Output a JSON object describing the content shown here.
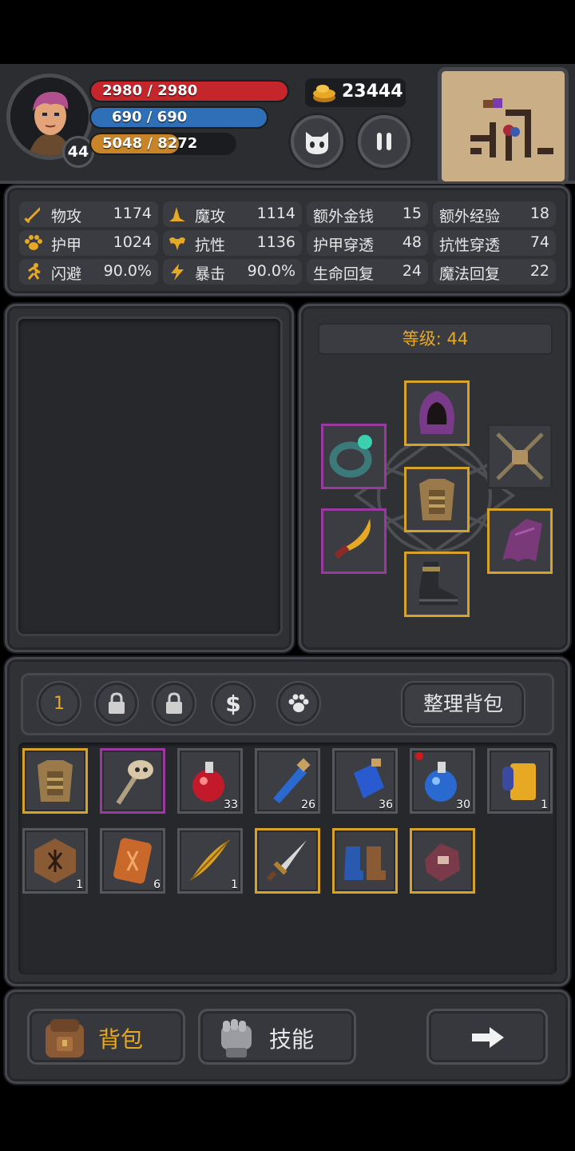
{
  "hud": {
    "hp": {
      "current": 2980,
      "max": 2980,
      "text": "2980 / 2980",
      "fraction": 1.0,
      "color": "#c5262c"
    },
    "mp": {
      "current": 690,
      "max": 690,
      "text": "690 / 690",
      "fraction": 1.0,
      "color": "#2f6fb8"
    },
    "xp": {
      "current": 5048,
      "max": 8272,
      "text": "5048 / 8272",
      "fraction": 0.61,
      "color": "#c98427"
    },
    "player_level": "44",
    "gold": "23444"
  },
  "stats": [
    {
      "label": "物攻",
      "value": "1174",
      "icon": "sword-icon"
    },
    {
      "label": "魔攻",
      "value": "1114",
      "icon": "wizard-hat-icon"
    },
    {
      "label": "额外金钱",
      "value": "15"
    },
    {
      "label": "额外经验",
      "value": "18"
    },
    {
      "label": "护甲",
      "value": "1024",
      "icon": "paw-icon"
    },
    {
      "label": "抗性",
      "value": "1136",
      "icon": "muscle-icon"
    },
    {
      "label": "护甲穿透",
      "value": "48"
    },
    {
      "label": "抗性穿透",
      "value": "74"
    },
    {
      "label": "闪避",
      "value": "90.0%",
      "icon": "running-icon"
    },
    {
      "label": "暴击",
      "value": "90.0%",
      "icon": "lightning-icon"
    },
    {
      "label": "生命回复",
      "value": "24"
    },
    {
      "label": "魔法回复",
      "value": "22"
    }
  ],
  "equipment": {
    "level_label": "等级: 44",
    "slots": [
      {
        "item": "hood",
        "rarity": "gold"
      },
      {
        "item": "ring",
        "rarity": "purple"
      },
      {
        "item": "chain-lock",
        "rarity": "none"
      },
      {
        "item": "chest-armor",
        "rarity": "gold"
      },
      {
        "item": "curved-dagger",
        "rarity": "purple"
      },
      {
        "item": "cloak",
        "rarity": "gold"
      },
      {
        "item": "boots",
        "rarity": "gold"
      }
    ]
  },
  "inventory_tabs": {
    "page_number": "1",
    "sort_button": "整理背包"
  },
  "inventory": [
    {
      "item": "chest-armor",
      "rarity": "gold",
      "count": ""
    },
    {
      "item": "skull-staff",
      "rarity": "purple",
      "count": ""
    },
    {
      "item": "red-potion",
      "rarity": "none",
      "count": "33"
    },
    {
      "item": "blue-vial",
      "rarity": "none",
      "count": "26"
    },
    {
      "item": "blue-bottle",
      "rarity": "none",
      "count": "36"
    },
    {
      "item": "blue-potion",
      "rarity": "none",
      "count": "30",
      "new": true
    },
    {
      "item": "scroll",
      "rarity": "none",
      "count": "1"
    },
    {
      "item": "rune-stone",
      "rarity": "none",
      "count": "1"
    },
    {
      "item": "rune-tablet",
      "rarity": "none",
      "count": "6"
    },
    {
      "item": "golden-feather",
      "rarity": "none",
      "count": "1"
    },
    {
      "item": "dagger",
      "rarity": "gold",
      "count": ""
    },
    {
      "item": "blue-boots",
      "rarity": "gold",
      "count": ""
    },
    {
      "item": "gauntlet",
      "rarity": "gold",
      "count": ""
    }
  ],
  "bottom_nav": {
    "bag": "背包",
    "skills": "技能"
  },
  "colors": {
    "accent": "#e7a824",
    "gold_border": "#d6a22a",
    "purple_border": "#9a3aa0"
  }
}
